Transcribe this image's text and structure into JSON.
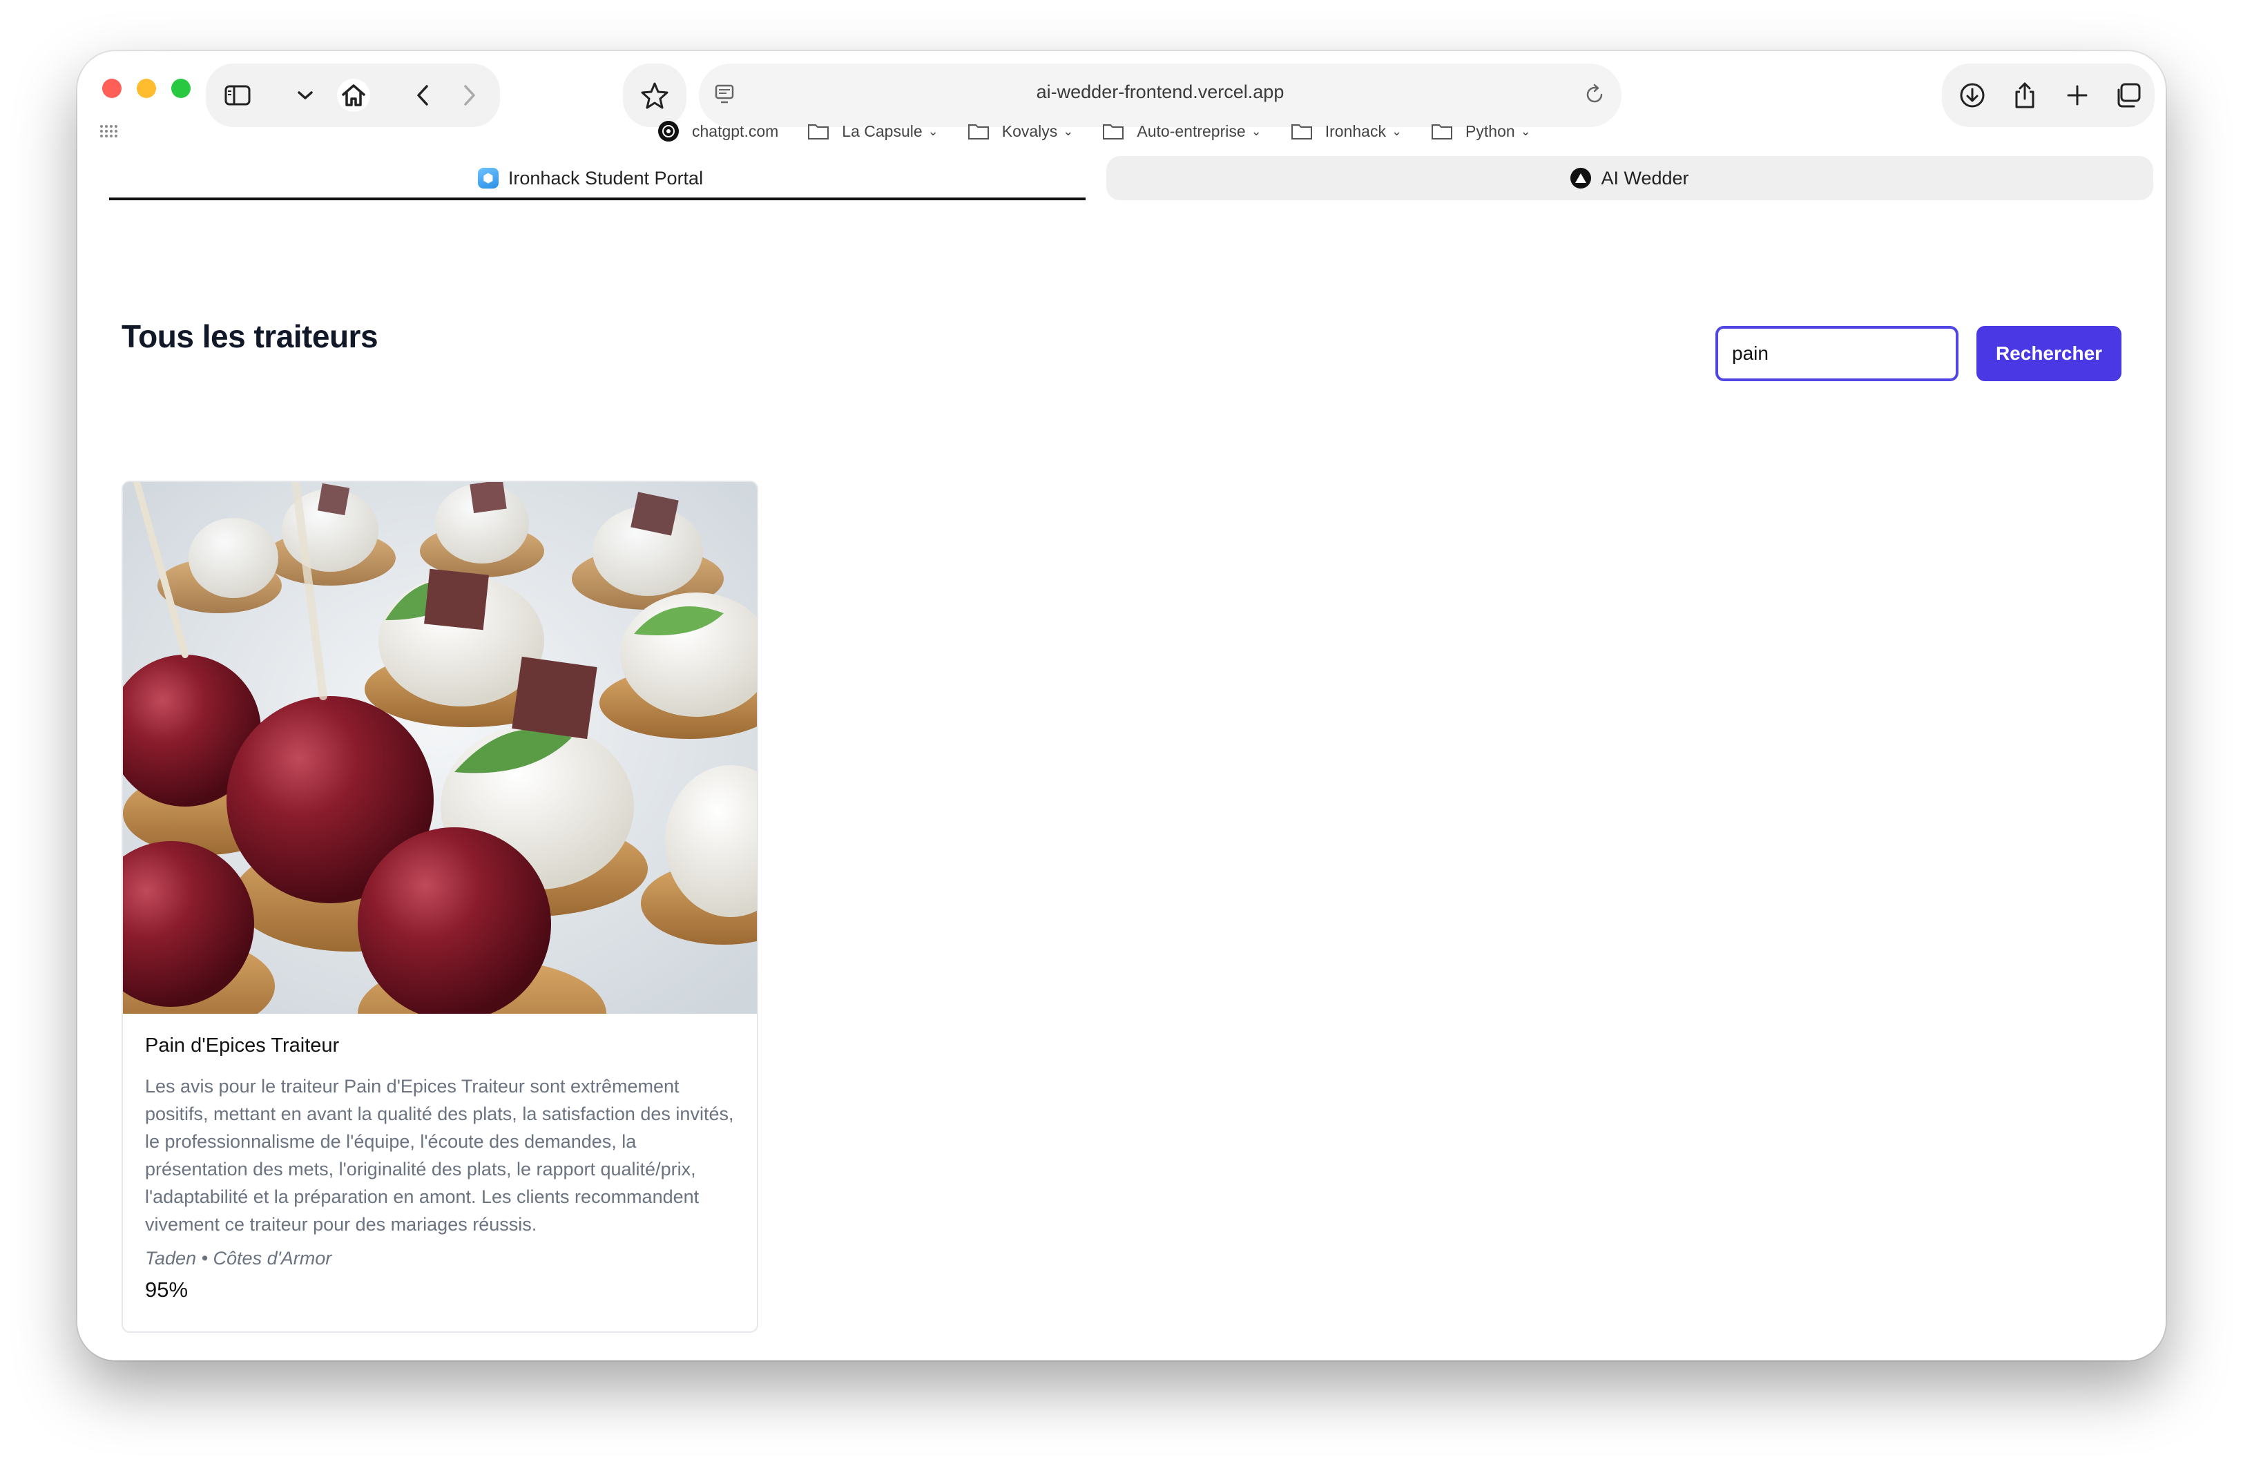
{
  "browser": {
    "url": "ai-wedder-frontend.vercel.app",
    "bookmarks": [
      {
        "label": "chatgpt.com",
        "icon": "chatgpt-icon",
        "folder": false
      },
      {
        "label": "La Capsule",
        "icon": "folder-icon",
        "folder": true
      },
      {
        "label": "Kovalys",
        "icon": "folder-icon",
        "folder": true
      },
      {
        "label": "Auto-entreprise",
        "icon": "folder-icon",
        "folder": true
      },
      {
        "label": "Ironhack",
        "icon": "folder-icon",
        "folder": true
      },
      {
        "label": "Python",
        "icon": "folder-icon",
        "folder": true
      }
    ],
    "tabs": [
      {
        "label": "Ironhack Student Portal",
        "active": true
      },
      {
        "label": "AI Wedder",
        "active": false
      }
    ]
  },
  "page": {
    "title": "Tous les traiteurs",
    "search": {
      "value": "pain",
      "button_label": "Rechercher"
    },
    "accent_color": "#4a38e5"
  },
  "results": [
    {
      "name": "Pain d'Epices Traiteur",
      "description": "Les avis pour le traiteur Pain d'Epices Traiteur sont extrêmement positifs, mettant en avant la qualité des plats, la satisfaction des invités, le professionnalisme de l'équipe, l'écoute des demandes, la présentation des mets, l'originalité des plats, le rapport qualité/prix, l'adaptabilité et la préparation en amont. Les clients recommandent vivement ce traiteur pour des mariages réussis.",
      "location": "Taden • Côtes d'Armor",
      "score": "95%"
    }
  ]
}
